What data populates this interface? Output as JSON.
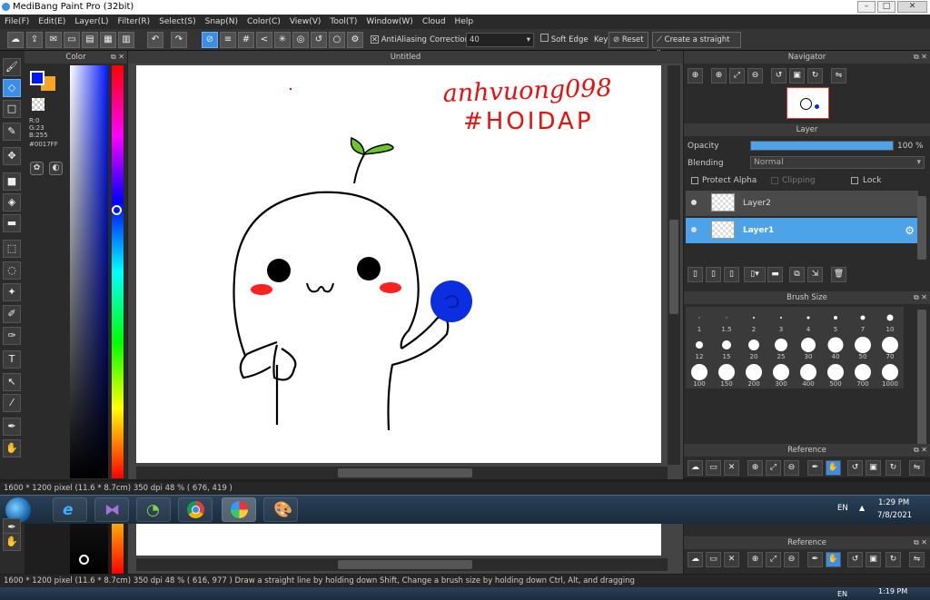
{
  "app": {
    "title": "MediBang Paint Pro (32bit)",
    "canvas_tab": "Untitled"
  },
  "window_controls": {
    "minimize": "–",
    "maximize": "□",
    "close": "✕"
  },
  "menu": [
    "File(F)",
    "Edit(E)",
    "Layer(L)",
    "Filter(R)",
    "Select(S)",
    "Snap(N)",
    "Color(C)",
    "View(V)",
    "Tool(T)",
    "Window(W)",
    "Cloud",
    "Help"
  ],
  "toolbar": {
    "antialiasing_label": "AntiAliasing",
    "correction_label": "Correction",
    "correction_value": "40",
    "soft_edge_label": "Soft Edge",
    "key_label": "Key",
    "reset_label": "Reset",
    "straight_line_label": "Create a straight line"
  },
  "color_panel": {
    "title": "Color",
    "r": "R:0",
    "g": "G:23",
    "b": "B:255",
    "hex": "#0017FF",
    "current_color": "#0017FF",
    "secondary_color": "#F5A623"
  },
  "canvas": {
    "drawing_text_line1": "anhvuong098",
    "drawing_text_line2": "#HOIDAP",
    "ink_color": "#e8100c",
    "leaf_color": "#6cc62a",
    "ball_color": "#0a2ee0",
    "cheek_color": "#ff2020"
  },
  "navigator": {
    "title": "Navigator"
  },
  "layer_panel": {
    "title": "Layer",
    "opacity_label": "Opacity",
    "opacity_value": "100 %",
    "opacity_percent": 100,
    "blending_label": "Blending",
    "blending_value": "Normal",
    "protect_alpha_label": "Protect Alpha",
    "clipping_label": "Clipping",
    "lock_label": "Lock",
    "layers": [
      {
        "name": "Layer2",
        "selected": false
      },
      {
        "name": "Layer1",
        "selected": true
      }
    ]
  },
  "brush_size": {
    "title": "Brush Size",
    "sizes": [
      "1",
      "1.5",
      "2",
      "3",
      "4",
      "5",
      "7",
      "10",
      "12",
      "15",
      "20",
      "25",
      "30",
      "40",
      "50",
      "70",
      "100",
      "150",
      "200",
      "300",
      "400",
      "500",
      "700",
      "1000"
    ]
  },
  "reference": {
    "title": "Reference"
  },
  "status": {
    "line1": "1600 * 1200 pixel   (11.6 * 8.7cm)   350 dpi   48 %   ( 676, 419 )",
    "line2": "1600 * 1200 pixel   (11.6 * 8.7cm)   350 dpi   48 %   ( 616, 977 )   Draw a straight line by holding down Shift, Change a brush size by holding down Ctrl, Alt, and dragging"
  },
  "taskbar": {
    "language": "EN",
    "time": "1:29 PM",
    "date": "7/8/2021",
    "time_lower": "1:19 PM",
    "language_lower": "EN"
  },
  "lower_reference_title": "Reference"
}
